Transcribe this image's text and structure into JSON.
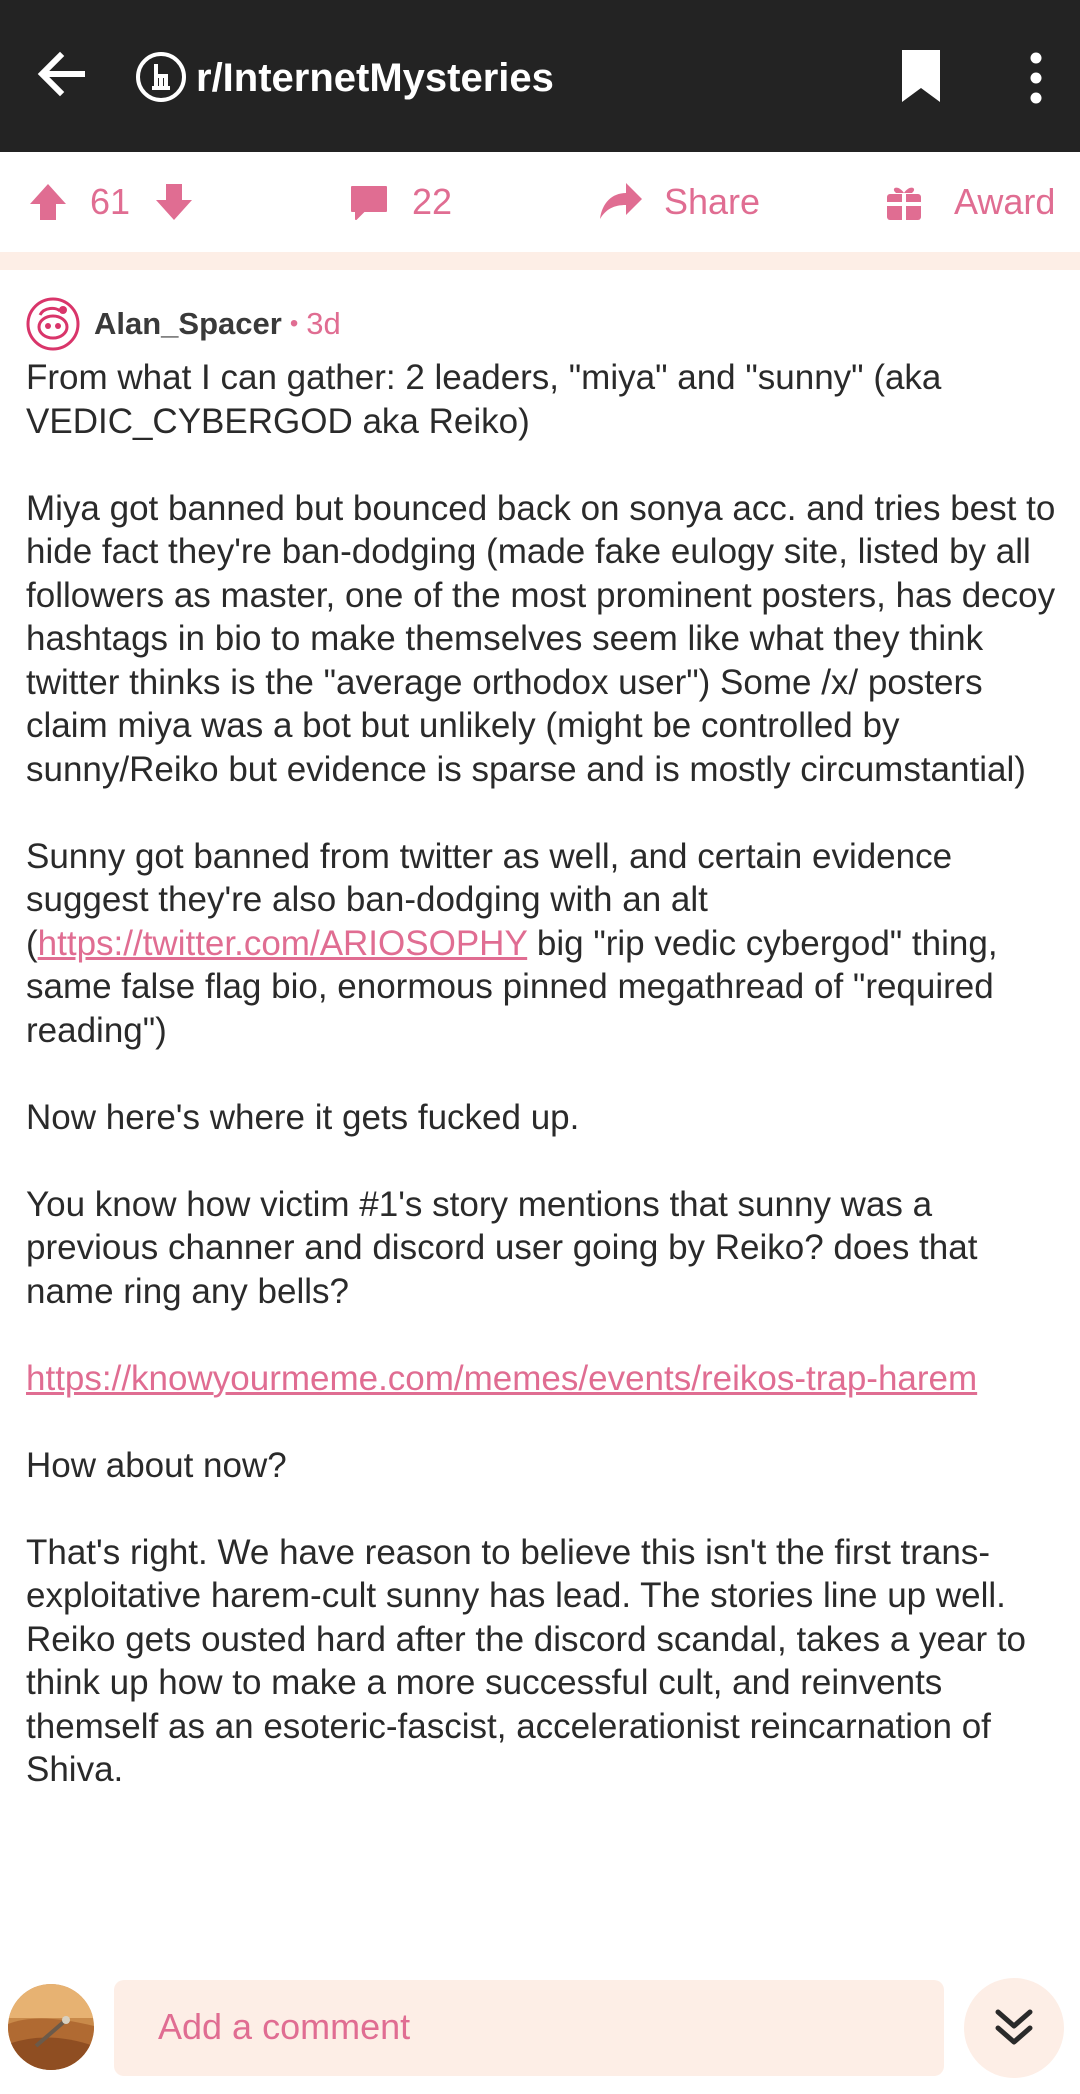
{
  "header": {
    "title": "r/InternetMysteries",
    "icons": [
      "back-arrow-icon",
      "subreddit-icon",
      "bookmark-icon",
      "more-vert-icon"
    ]
  },
  "actions": {
    "upvotes": "61",
    "comments": "22",
    "share_label": "Share",
    "award_label": "Award"
  },
  "post": {
    "author": "Alan_Spacer",
    "separator": "•",
    "age": "3d",
    "paragraphs": {
      "p1": "From what I can gather: 2 leaders, \"miya\" and \"sunny\" (aka VEDIC_CYBERGOD aka Reiko)",
      "p2": "Miya got banned but bounced back on sonya acc. and tries best to hide fact they're ban-dodging (made fake eulogy site, listed by all followers as master, one of the most prominent posters, has decoy hashtags in bio to make themselves seem like what they think twitter thinks is the \"average orthodox user\") Some /x/ posters claim miya was a bot but unlikely (might be controlled by sunny/Reiko but evidence is sparse and is mostly circumstantial)",
      "p3_before": "Sunny got banned from twitter as well, and certain evidence suggest they're also ban-dodging with an alt (",
      "p3_link": "https://twitter.com/ARIOSOPHY",
      "p3_after": " big \"rip vedic cybergod\" thing, same false flag bio, enormous pinned megathread of \"required reading\")",
      "p4": "Now here's where it gets fucked up.",
      "p5": "You know how victim #1's story mentions that sunny was a previous channer and discord user going by Reiko? does that name ring any bells?",
      "p6_link": "https://knowyourmeme.com/memes/events/reikos-trap-harem",
      "p7": "How about now?",
      "p8": "That's right. We have reason to believe this isn't the first trans-exploitative harem-cult sunny has lead. The stories line up well. Reiko gets ousted hard after the discord scandal, takes a year to think up how to make a more successful cult, and reinvents themself as an esoteric-fascist, accelerationist reincarnation of Shiva."
    }
  },
  "bottom": {
    "comment_placeholder": "Add a comment"
  },
  "colors": {
    "accent": "#e06d92",
    "topbar": "#232323",
    "divider": "#fdeee6"
  }
}
